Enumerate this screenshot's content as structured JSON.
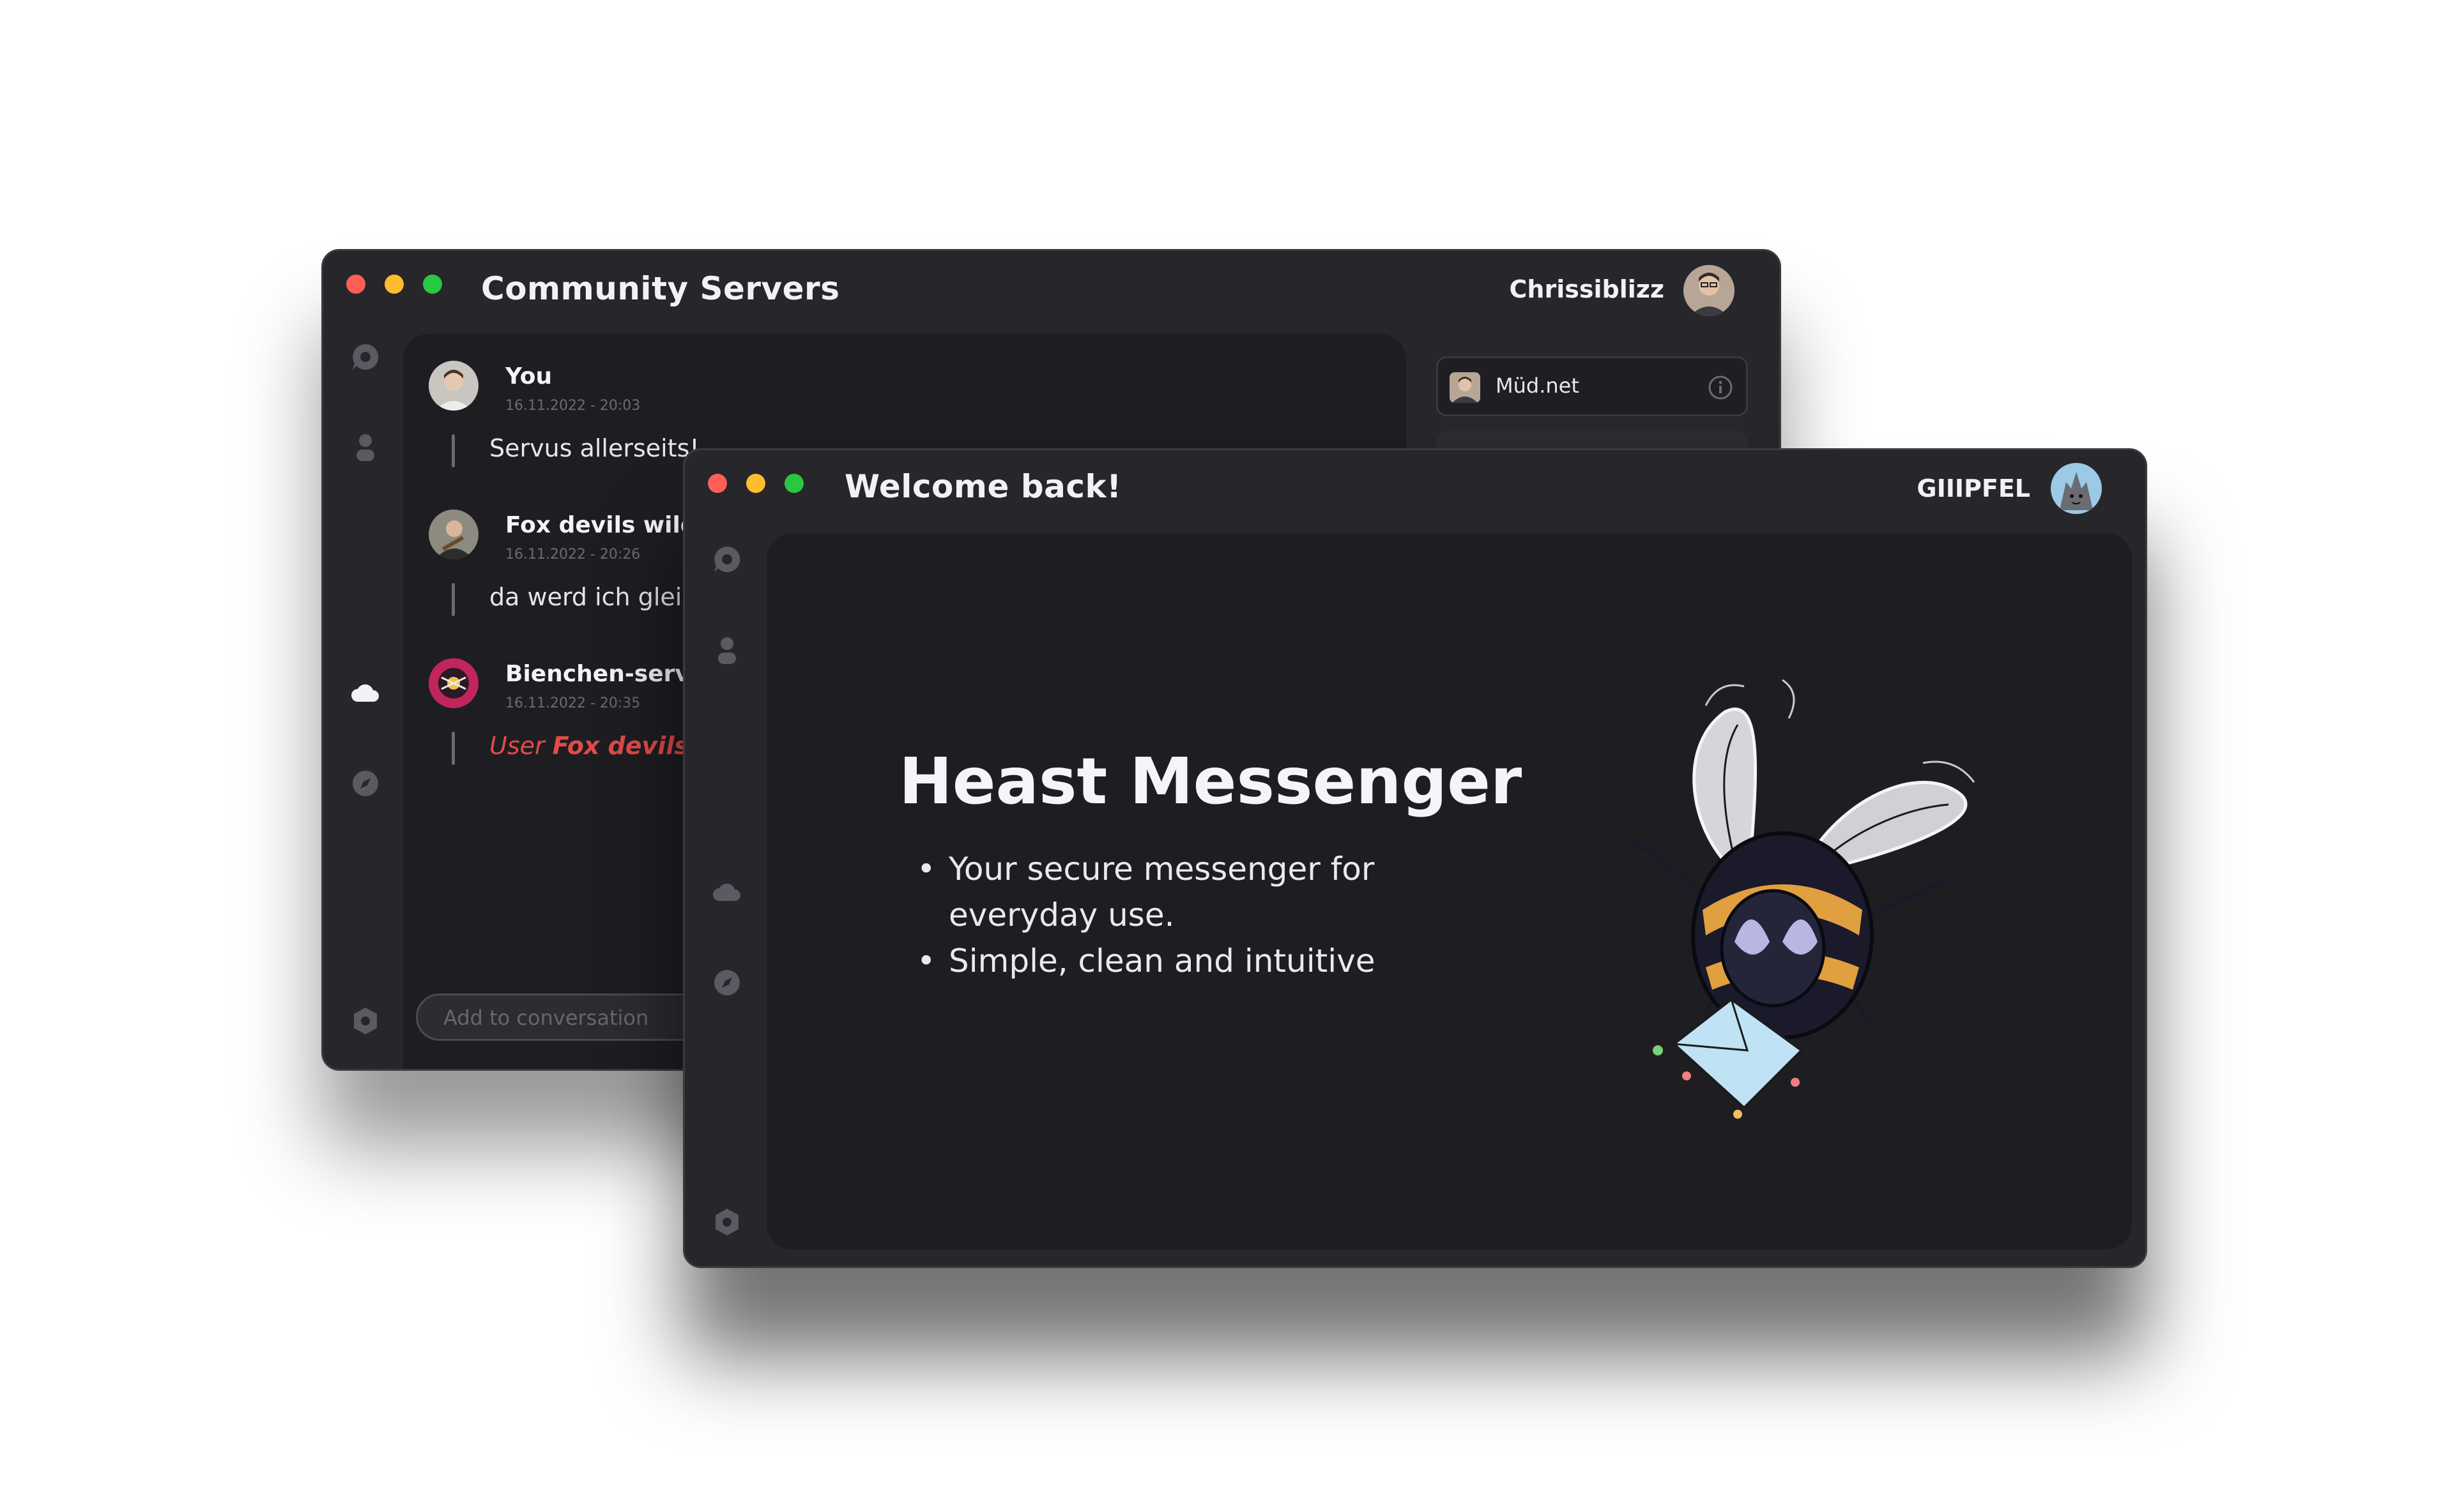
{
  "back_window": {
    "title": "Community Servers",
    "user_name": "Chrissiblizz",
    "messages": [
      {
        "author": "You",
        "date": "16.11.2022 - 20:03",
        "text": "Servus allerseits!"
      },
      {
        "author": "Fox devils wild",
        "date": "16.11.2022 - 20:26",
        "text": "da werd ich gleic"
      },
      {
        "author": "Bienchen-servi",
        "date": "16.11.2022 - 20:35",
        "text_prefix": "User ",
        "text_bold": "Fox devils"
      }
    ],
    "compose_placeholder": "Add to conversation",
    "servers": [
      {
        "name": "Müd.net"
      }
    ],
    "sidebar_icons": [
      "chat-bubble-icon",
      "person-icon",
      "cloud-icon",
      "compass-icon",
      "settings-hexagon-icon"
    ]
  },
  "front_window": {
    "title": "Welcome back!",
    "user_name": "GIIIPFEL",
    "hero": {
      "title": "Heast Messenger",
      "bullets": [
        "Your secure messenger for everyday use.",
        "Simple, clean and intuitive"
      ]
    },
    "sidebar_icons": [
      "chat-bubble-icon",
      "person-icon",
      "cloud-icon",
      "compass-icon",
      "settings-hexagon-icon"
    ]
  },
  "colors": {
    "window_bg": "#26262b",
    "panel_bg": "#1e1e22",
    "text": "#f2f2f4",
    "system_message": "#e24b48",
    "traffic_red": "#ff5f57",
    "traffic_yellow": "#febc2e",
    "traffic_green": "#28c840"
  }
}
